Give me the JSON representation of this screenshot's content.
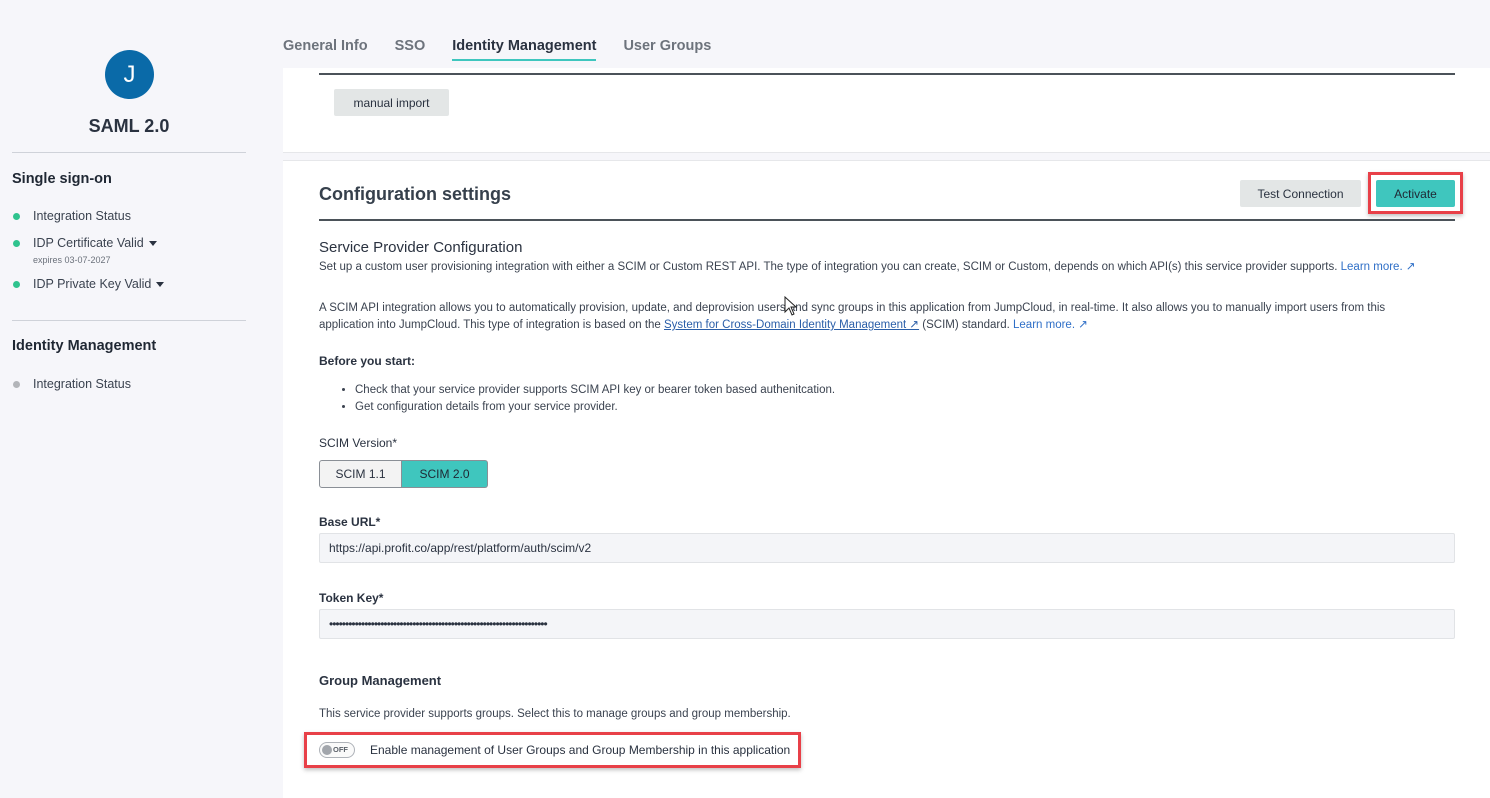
{
  "sidebar": {
    "avatar_initial": "J",
    "app_title": "SAML 2.0",
    "sso_section": {
      "title": "Single sign-on",
      "items": [
        {
          "label": "Integration Status",
          "status": "green"
        },
        {
          "label": "IDP Certificate Valid",
          "status": "green",
          "note": "expires 03-07-2027"
        },
        {
          "label": "IDP Private Key Valid",
          "status": "green"
        }
      ]
    },
    "idm_section": {
      "title": "Identity Management",
      "items": [
        {
          "label": "Integration Status",
          "status": "gray"
        }
      ]
    }
  },
  "tabs": [
    {
      "label": "General Info",
      "active": false
    },
    {
      "label": "SSO",
      "active": false
    },
    {
      "label": "Identity Management",
      "active": true
    },
    {
      "label": "User Groups",
      "active": false
    }
  ],
  "top_card": {
    "manual_import_label": "manual import"
  },
  "config": {
    "title": "Configuration settings",
    "test_connection_label": "Test Connection",
    "activate_label": "Activate",
    "sp_config_title": "Service Provider Configuration",
    "intro_text": "Set up a custom user provisioning integration with either a SCIM or Custom REST API. The type of integration you can create, SCIM or Custom, depends on which API(s) this service provider supports. ",
    "learn_more_1": "Learn more. ↗",
    "scim_text_1": "A SCIM API integration allows you to automatically provision, update, and deprovision users and sync groups in this application from JumpCloud, in real-time. It also allows you to manually import users from this application into JumpCloud. This type of integration is based on the ",
    "scim_link": "System for Cross-Domain Identity Management ↗",
    "scim_text_2": " (SCIM) standard. ",
    "learn_more_2": "Learn more. ↗",
    "before_start_label": "Before you start:",
    "bullets": [
      "Check that your service provider supports SCIM API key or bearer token based authenitcation.",
      "Get configuration details from your service provider."
    ],
    "scim_version_label": "SCIM Version*",
    "scim_versions": [
      {
        "label": "SCIM 1.1",
        "selected": false
      },
      {
        "label": "SCIM 2.0",
        "selected": true
      }
    ],
    "base_url_label": "Base URL*",
    "base_url_value": "https://api.profit.co/app/rest/platform/auth/scim/v2",
    "token_key_label": "Token Key*",
    "token_key_value": "••••••••••••••••••••••••••••••••••••••••••••••••••••••••••••••••••••",
    "group_mgmt_title": "Group Management",
    "group_mgmt_text": "This service provider supports groups. Select this to manage groups and group membership.",
    "group_toggle_state": "OFF",
    "group_toggle_label": "Enable management of User Groups and Group Membership in this application"
  },
  "colors": {
    "accent": "#3fc6be",
    "avatar": "#0a6aa8",
    "status_green": "#2fc38e",
    "highlight": "#e84048",
    "link": "#2f6fc7"
  }
}
